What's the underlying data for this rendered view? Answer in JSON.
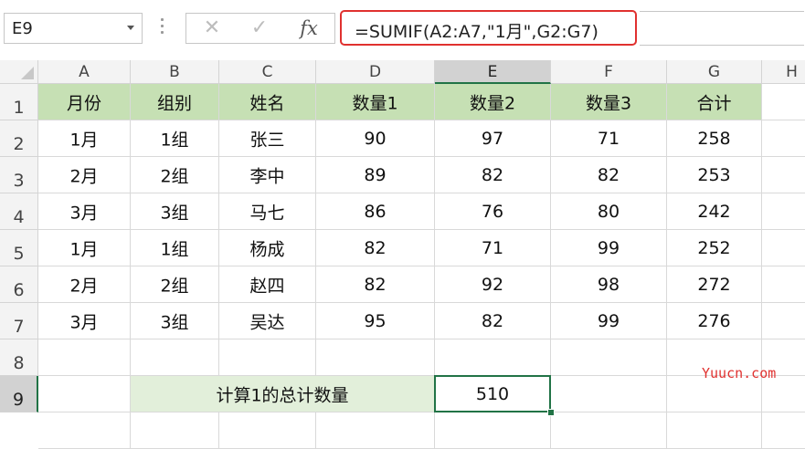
{
  "name_box": {
    "value": "E9"
  },
  "formula_bar": {
    "cancel_glyph": "✕",
    "enter_glyph": "✓",
    "fx_label": "fx",
    "formula": "=SUMIF(A2:A7,\"1月\",G2:G7)",
    "highlight_color": "#e0312f"
  },
  "columns": [
    "A",
    "B",
    "C",
    "D",
    "E",
    "F",
    "G",
    "H"
  ],
  "rows": [
    "1",
    "2",
    "3",
    "4",
    "5",
    "6",
    "7",
    "8",
    "9"
  ],
  "selected_cell": {
    "column": "E",
    "row": "9"
  },
  "table": {
    "header": [
      "月份",
      "组别",
      "姓名",
      "数量1",
      "数量2",
      "数量3",
      "合计"
    ],
    "rows": [
      [
        "1月",
        "1组",
        "张三",
        "90",
        "97",
        "71",
        "258"
      ],
      [
        "2月",
        "2组",
        "李中",
        "89",
        "82",
        "82",
        "253"
      ],
      [
        "3月",
        "3组",
        "马七",
        "86",
        "76",
        "80",
        "242"
      ],
      [
        "1月",
        "1组",
        "杨成",
        "82",
        "71",
        "99",
        "252"
      ],
      [
        "2月",
        "2组",
        "赵四",
        "82",
        "92",
        "98",
        "272"
      ],
      [
        "3月",
        "3组",
        "吴达",
        "95",
        "82",
        "99",
        "276"
      ]
    ]
  },
  "summary": {
    "label": "计算1的总计数量",
    "value": "510"
  },
  "colors": {
    "header_fill": "#c6e0b4",
    "label_fill": "#e2efda",
    "selection_green": "#217346"
  },
  "watermark": "Yuucn.com"
}
